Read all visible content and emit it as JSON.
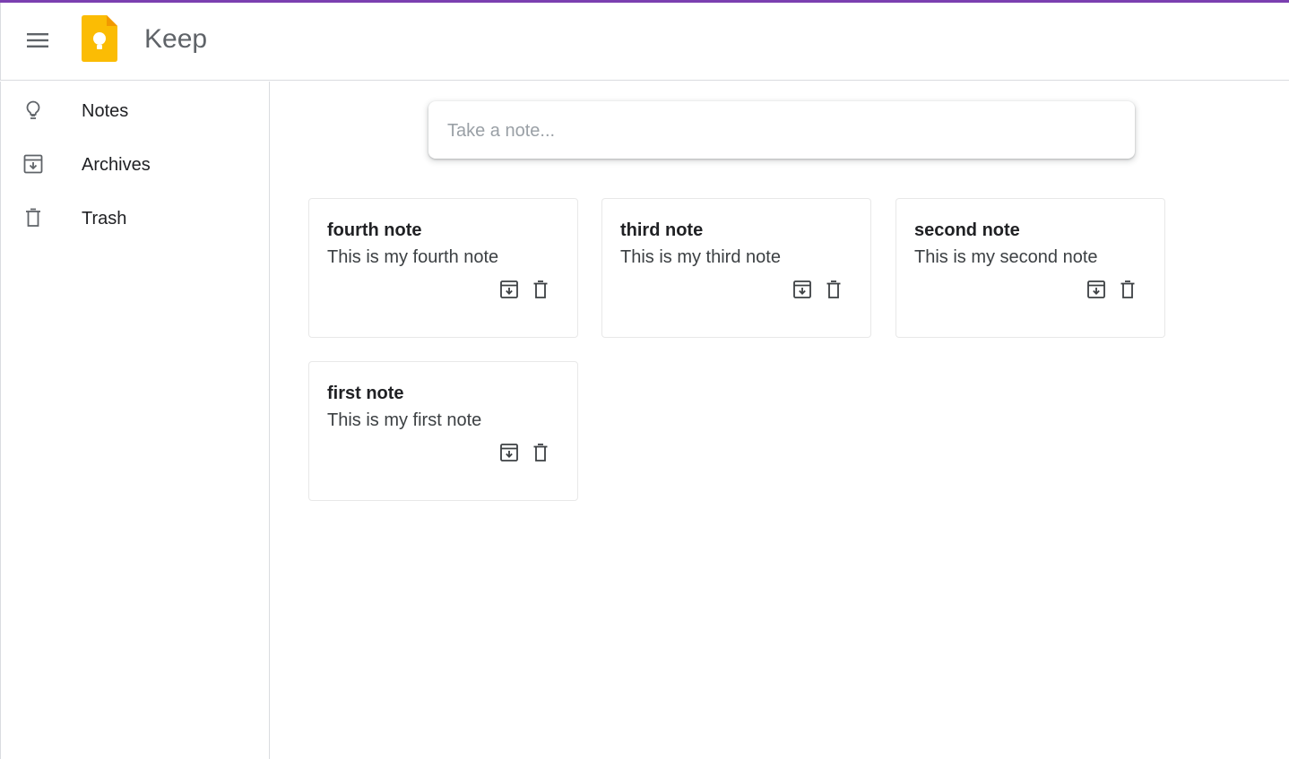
{
  "header": {
    "app_title": "Keep",
    "menu_icon": "hamburger-menu-icon",
    "logo_icon": "keep-logo-icon",
    "accent_color": "#7b3fb0",
    "logo_color": "#fbbc04"
  },
  "sidebar": {
    "items": [
      {
        "label": "Notes",
        "icon": "lightbulb-icon"
      },
      {
        "label": "Archives",
        "icon": "archive-icon"
      },
      {
        "label": "Trash",
        "icon": "trash-icon"
      }
    ]
  },
  "composer": {
    "placeholder": "Take a note..."
  },
  "notes": [
    {
      "title": "fourth note",
      "body": "This is my fourth note"
    },
    {
      "title": "third note",
      "body": "This is my third note"
    },
    {
      "title": "second note",
      "body": "This is my second note"
    },
    {
      "title": "first note",
      "body": "This is my first note"
    }
  ],
  "note_actions": {
    "archive_icon": "archive-icon",
    "delete_icon": "trash-icon"
  }
}
